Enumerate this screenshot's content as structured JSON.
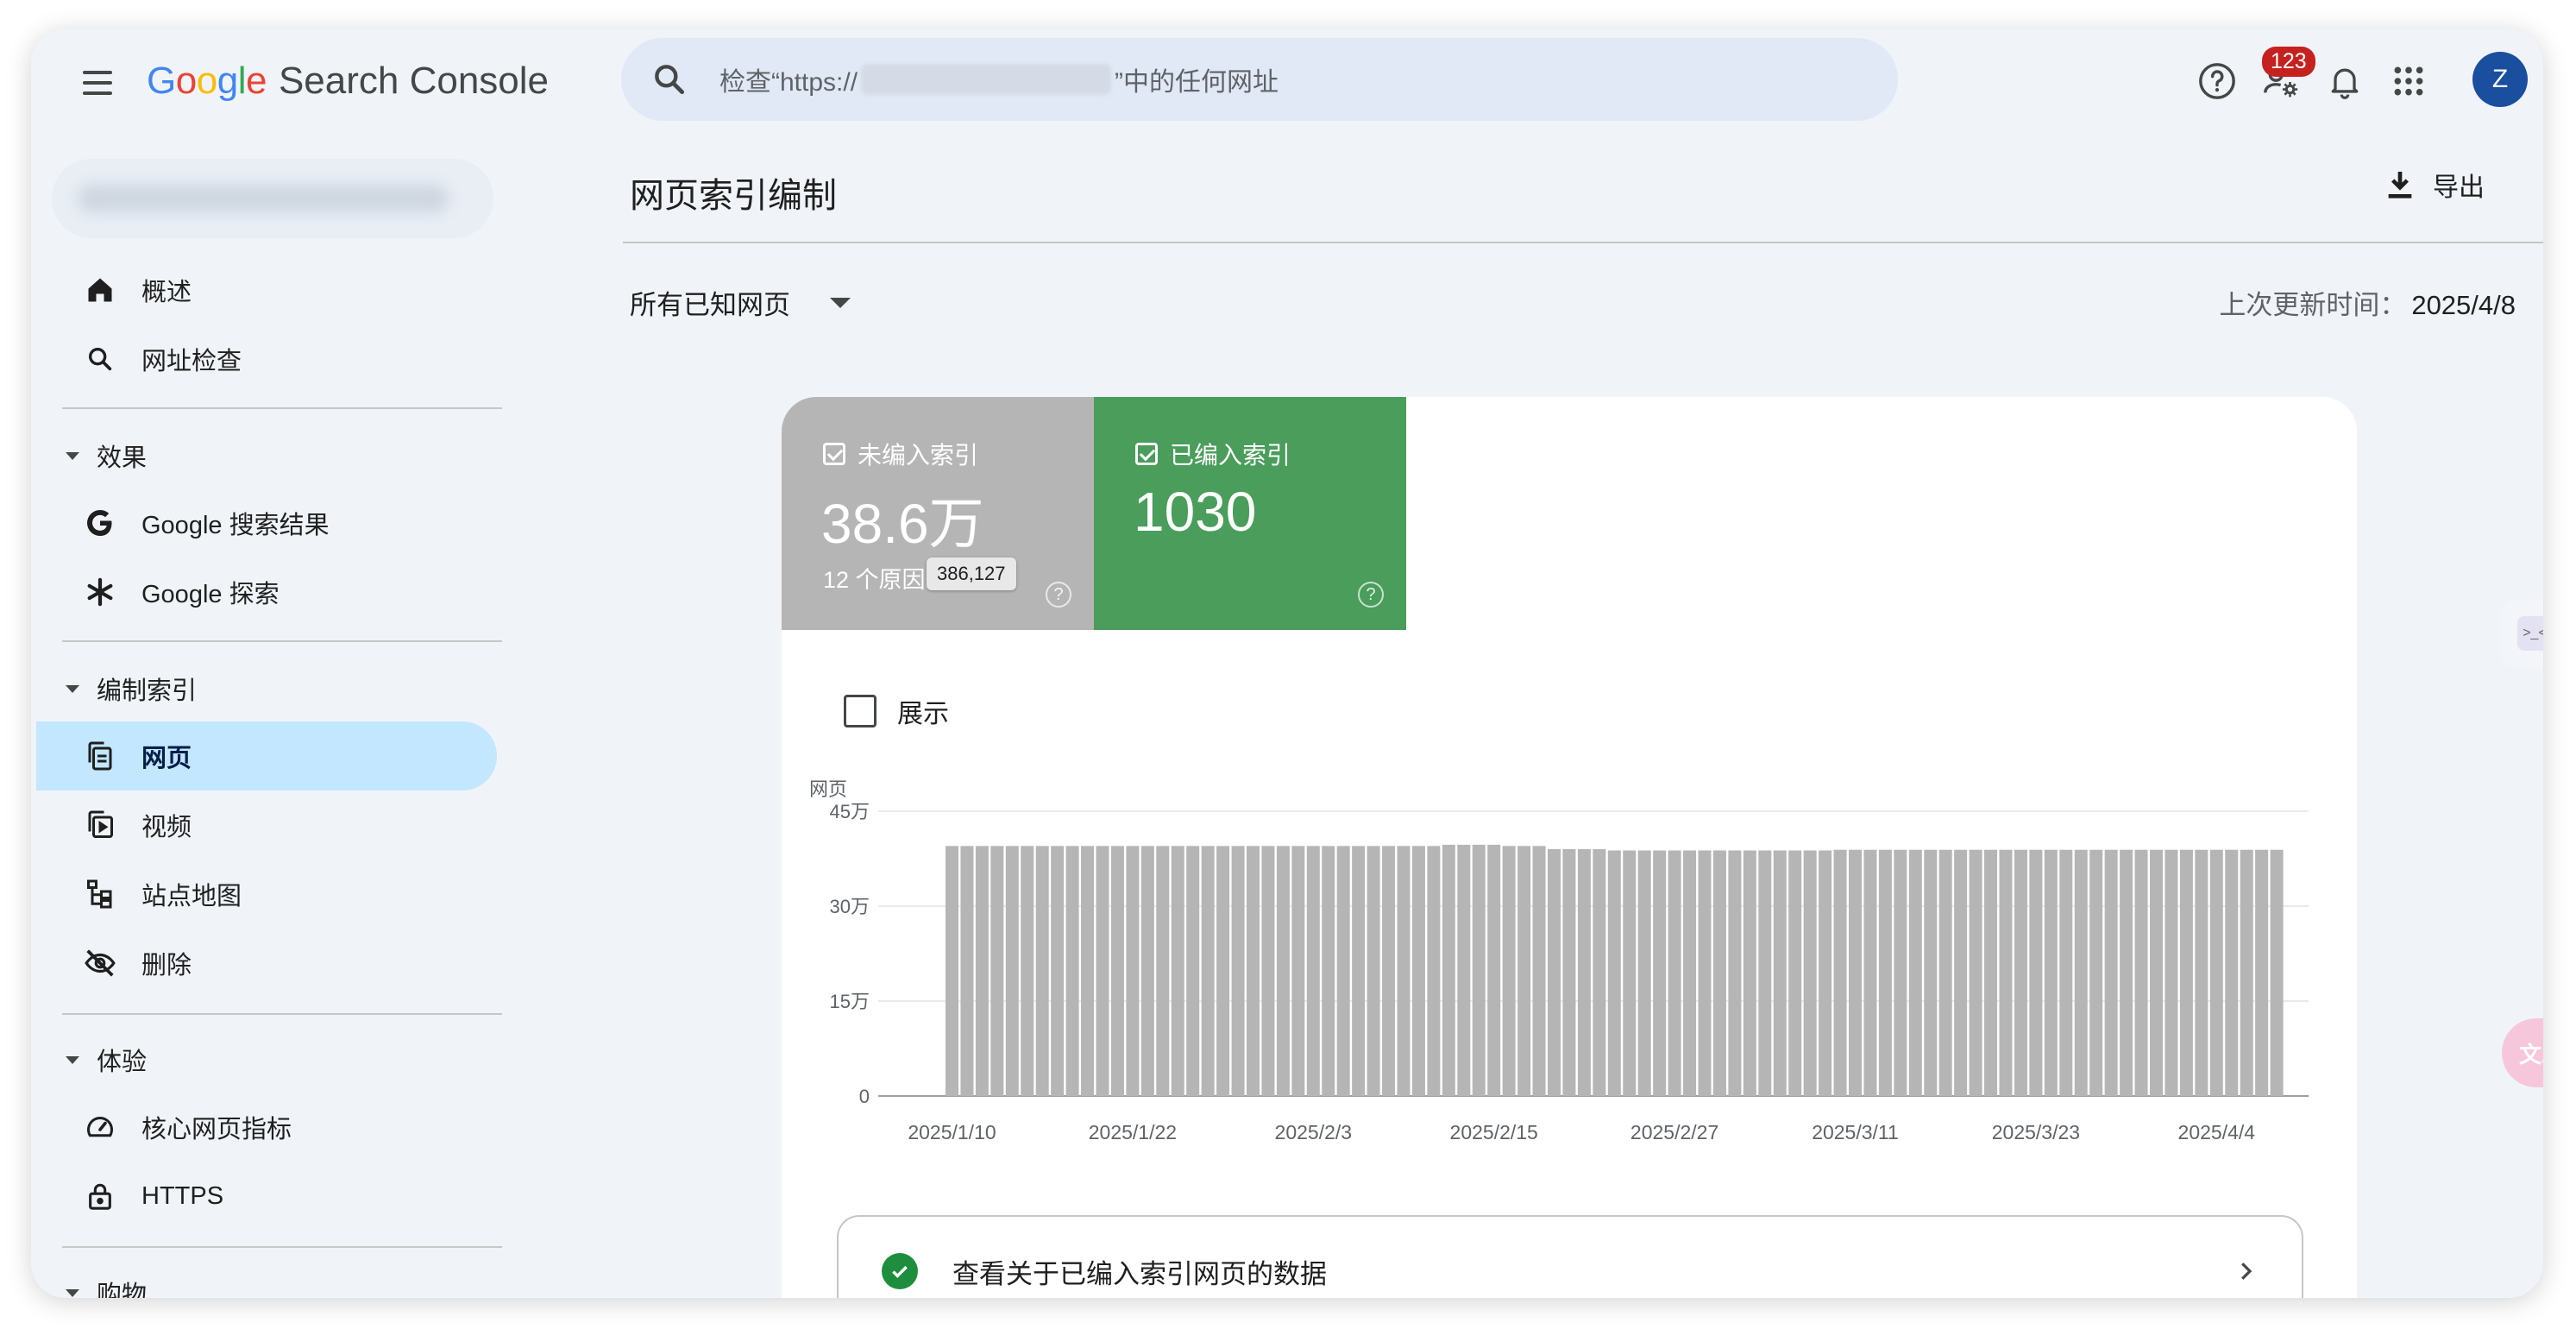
{
  "header": {
    "logo_google": "Google",
    "logo_product": "Search Console",
    "search_placeholder_prefix": "检查“https://",
    "search_placeholder_suffix": "”中的任何网址",
    "notification_count": "123",
    "avatar_letter": "Z"
  },
  "sidebar": {
    "items_top": [
      {
        "label": "概述",
        "icon": "home-icon"
      },
      {
        "label": "网址检查",
        "icon": "search-icon"
      }
    ],
    "sections": [
      {
        "title": "效果",
        "items": [
          {
            "label": "Google 搜索结果",
            "icon": "google-g-icon"
          },
          {
            "label": "Google 探索",
            "icon": "asterisk-icon"
          }
        ]
      },
      {
        "title": "编制索引",
        "items": [
          {
            "label": "网页",
            "icon": "pages-icon",
            "active": true
          },
          {
            "label": "视频",
            "icon": "video-icon"
          },
          {
            "label": "站点地图",
            "icon": "sitemap-icon"
          },
          {
            "label": "删除",
            "icon": "removals-icon"
          }
        ]
      },
      {
        "title": "体验",
        "items": [
          {
            "label": "核心网页指标",
            "icon": "speedometer-icon"
          },
          {
            "label": "HTTPS",
            "icon": "lock-icon"
          }
        ]
      },
      {
        "title": "购物",
        "items": []
      }
    ]
  },
  "main": {
    "title": "网页索引编制",
    "export_label": "导出",
    "filter_label": "所有已知网页",
    "updated_label": "上次更新时间：",
    "updated_value": "2025/4/8",
    "metrics": {
      "not_indexed": {
        "label": "未编入索引",
        "value": "38.6万",
        "sub": "12 个原因",
        "tooltip": "386,127"
      },
      "indexed": {
        "label": "已编入索引",
        "value": "1030"
      }
    },
    "show_label": "展示",
    "link_label": "查看关于已编入索引网页的数据"
  },
  "colors": {
    "not_indexed": "#b5b5b5",
    "indexed": "#4a9d5b",
    "active_nav": "#c2e7ff",
    "accent_blue": "#1a4e9e"
  },
  "chart_data": {
    "type": "bar",
    "ylabel": "网页",
    "ylim": [
      0,
      450000
    ],
    "y_ticks": [
      "0",
      "15万",
      "30万",
      "45万"
    ],
    "x_tick_labels": [
      "2025/1/10",
      "2025/1/22",
      "2025/2/3",
      "2025/2/15",
      "2025/2/27",
      "2025/3/11",
      "2025/3/23",
      "2025/4/4"
    ],
    "x_start": "2025/1/10",
    "series": [
      {
        "values": [
          395000,
          395000,
          395000,
          395000,
          395000,
          395000,
          395000,
          395000,
          395000,
          395000,
          395000,
          395000,
          395000,
          395000,
          395000,
          395000,
          395000,
          395000,
          395000,
          395000,
          395000,
          395000,
          395000,
          395000,
          395000,
          395000,
          395000,
          395000,
          395000,
          395000,
          395000,
          395000,
          395000,
          397000,
          397000,
          397000,
          397000,
          395000,
          395000,
          395000,
          390000,
          390000,
          390000,
          390000,
          388000,
          388000,
          388000,
          388000,
          388000,
          388000,
          388000,
          388000,
          388000,
          388000,
          388000,
          388000,
          388000,
          388000,
          388000,
          389000,
          389000,
          389000,
          389000,
          389000,
          389000,
          389000,
          389000,
          389000,
          389000,
          389000,
          389000,
          389000,
          389000,
          389000,
          389000,
          389000,
          389000,
          389000,
          389000,
          389000,
          389000,
          389000,
          389000,
          389000,
          389000,
          389000,
          389000,
          389000,
          389000
        ]
      }
    ]
  }
}
